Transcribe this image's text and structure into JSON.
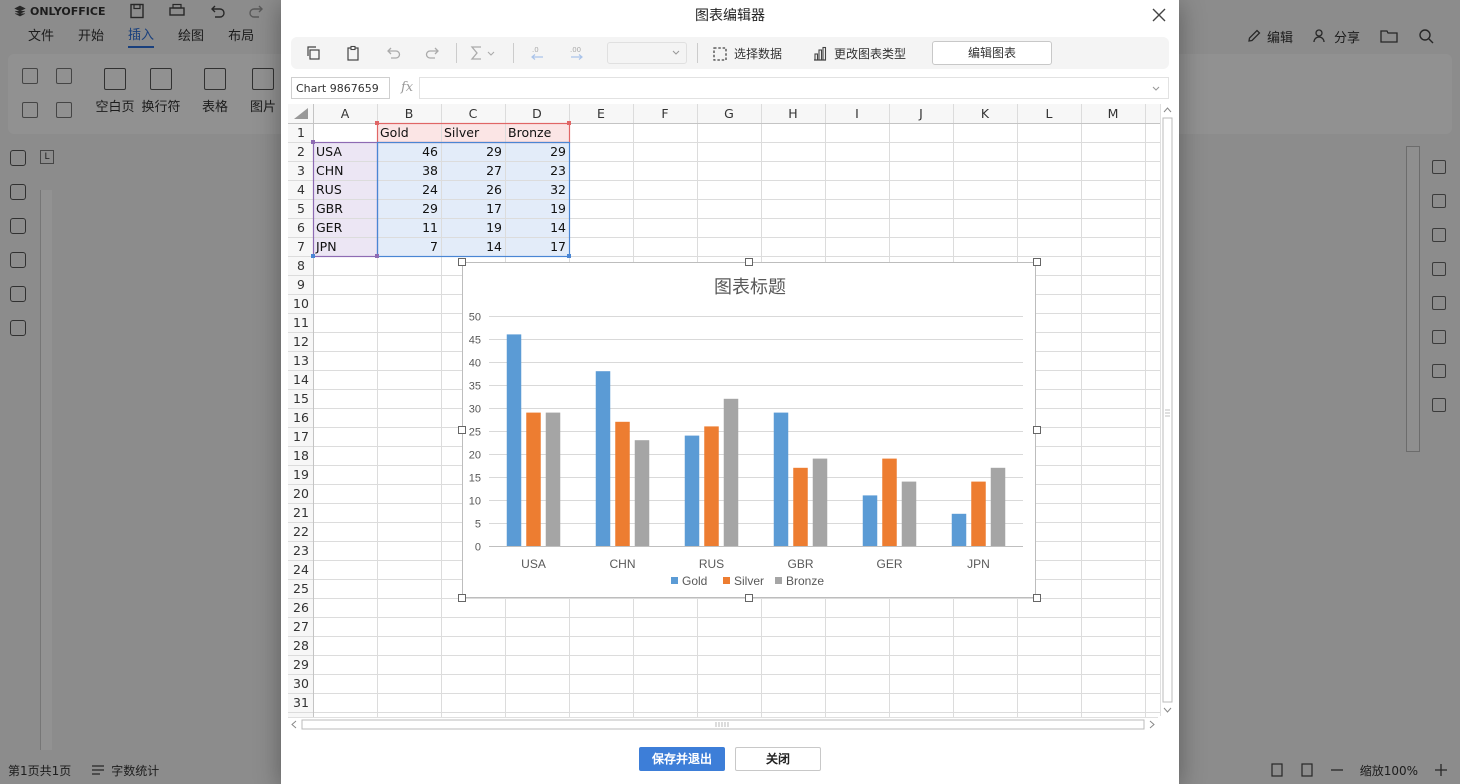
{
  "app": {
    "brand": "ONLYOFFICE",
    "menu_tabs": [
      "文件",
      "开始",
      "插入",
      "绘图",
      "布局"
    ],
    "active_tab": "插入",
    "right_actions": {
      "edit": "编辑",
      "share": "分享"
    },
    "ribbon": {
      "blank_page": "空白页",
      "line_break": "换行符",
      "table": "表格",
      "picture": "图片"
    },
    "status": {
      "page": "第1页共1页",
      "word_count": "字数统计",
      "zoom": "缩放100%"
    }
  },
  "dialog": {
    "title": "图表编辑器",
    "toolbar": {
      "select_data": "选择数据",
      "change_type": "更改图表类型",
      "edit_chart": "编辑图表"
    },
    "name_box": "Chart 9867659",
    "fx": "fx",
    "footer": {
      "save_exit": "保存并退出",
      "close": "关闭"
    }
  },
  "sheet": {
    "columns": [
      "A",
      "B",
      "C",
      "D",
      "E",
      "F",
      "G",
      "H",
      "I",
      "J",
      "K",
      "L",
      "M"
    ],
    "row_count": 31,
    "headers": [
      "Gold",
      "Silver",
      "Bronze"
    ],
    "rows": [
      {
        "label": "USA",
        "values": [
          "46",
          "29",
          "29"
        ]
      },
      {
        "label": "CHN",
        "values": [
          "38",
          "27",
          "23"
        ]
      },
      {
        "label": "RUS",
        "values": [
          "24",
          "26",
          "32"
        ]
      },
      {
        "label": "GBR",
        "values": [
          "29",
          "17",
          "19"
        ]
      },
      {
        "label": "GER",
        "values": [
          "11",
          "19",
          "14"
        ]
      },
      {
        "label": "JPN",
        "values": [
          "7",
          "14",
          "17"
        ]
      }
    ]
  },
  "chart_data": {
    "type": "bar",
    "title": "图表标题",
    "categories": [
      "USA",
      "CHN",
      "RUS",
      "GBR",
      "GER",
      "JPN"
    ],
    "series": [
      {
        "name": "Gold",
        "values": [
          46,
          38,
          24,
          29,
          11,
          7
        ],
        "color": "#5b9bd5"
      },
      {
        "name": "Silver",
        "values": [
          29,
          27,
          26,
          17,
          19,
          14
        ],
        "color": "#ed7d31"
      },
      {
        "name": "Bronze",
        "values": [
          29,
          23,
          32,
          19,
          14,
          17
        ],
        "color": "#a5a5a5"
      }
    ],
    "ylim": [
      0,
      50
    ],
    "yticks": [
      "0",
      "5",
      "10",
      "15",
      "20",
      "25",
      "30",
      "35",
      "40",
      "45",
      "50"
    ],
    "grid": true,
    "legend": "bottom"
  }
}
